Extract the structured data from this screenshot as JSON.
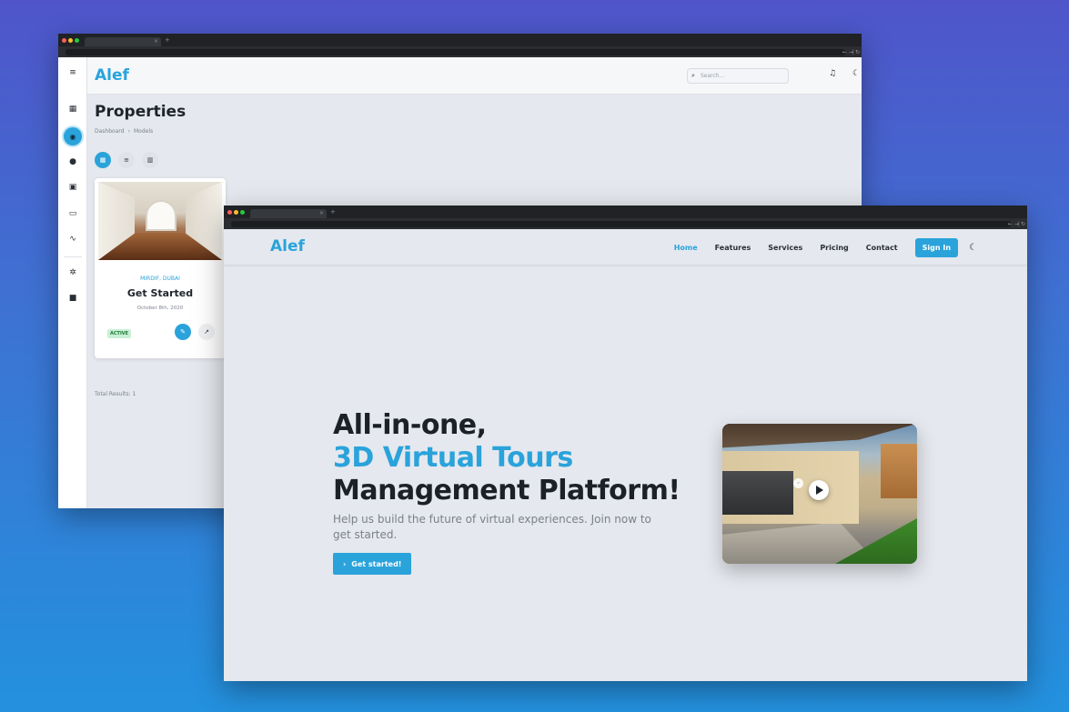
{
  "dashboard": {
    "brand": "Alef",
    "search_placeholder": "Search...",
    "page_title": "Properties",
    "breadcrumb": [
      "Dashboard",
      "Models"
    ],
    "breadcrumb_separator": "›",
    "view_buttons": [
      "grid-icon",
      "list-icon",
      "map-icon"
    ],
    "sidebar_icons": [
      "menu-icon",
      "dashboard-icon",
      "models-icon",
      "users-icon",
      "storage-icon",
      "calendar-icon",
      "activity-icon",
      "settings-icon",
      "help-icon"
    ],
    "property": {
      "location": "MIRDIF, DUBAI",
      "name": "Get Started",
      "date": "October 8th, 2020",
      "status": "ACTIVE"
    },
    "total_results": "Total Results: 1"
  },
  "landing": {
    "brand": "Alef",
    "nav": [
      "Home",
      "Features",
      "Services",
      "Pricing",
      "Contact"
    ],
    "active_nav": "Home",
    "signin": "Sign In",
    "hero": {
      "line1": "All-in-one,",
      "line2": "3D Virtual Tours",
      "line3": "Management Platform!",
      "subtitle": "Help us build the future of virtual experiences. Join now to get started.",
      "cta": "Get started!"
    }
  },
  "colors": {
    "accent": "#2aa3db",
    "active_badge_bg": "#c9f0d4",
    "active_badge_text": "#1f7a3b",
    "background_top": "#4f55c9",
    "background_bottom": "#2391de"
  }
}
